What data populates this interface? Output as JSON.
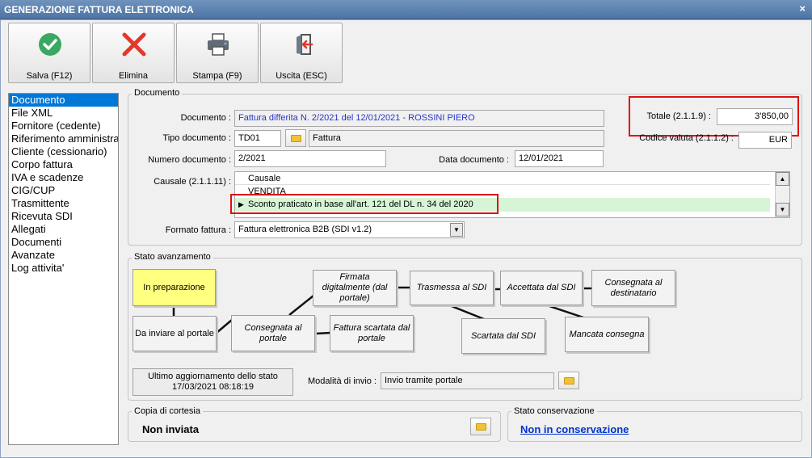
{
  "window": {
    "title": "GENERAZIONE FATTURA ELETTRONICA",
    "close": "×"
  },
  "toolbar": {
    "save": "Salva (F12)",
    "delete": "Elimina",
    "print": "Stampa (F9)",
    "exit": "Uscita (ESC)"
  },
  "nav": {
    "items": [
      "Documento",
      "File XML",
      "Fornitore (cedente)",
      "Riferimento amministrativo",
      "Cliente (cessionario)",
      "Corpo fattura",
      "IVA e scadenze",
      "CIG/CUP",
      "Trasmittente",
      "Ricevuta SDI",
      "Allegati",
      "Documenti",
      "Avanzate",
      "Log attivita'"
    ],
    "selected": "Documento"
  },
  "documento": {
    "group": "Documento",
    "doc_label": "Documento :",
    "doc_value": "Fattura differita N. 2/2021 del 12/01/2021 - ROSSINI PIERO",
    "totale_label": "Totale (2.1.1.9) :",
    "totale_value": "3'850,00",
    "tipo_label": "Tipo documento :",
    "tipo_code": "TD01",
    "tipo_desc": "Fattura",
    "valuta_label": "Codice valuta (2.1.1.2) :",
    "valuta_value": "EUR",
    "numero_label": "Numero documento :",
    "numero_value": "2/2021",
    "data_label": "Data documento :",
    "data_value": "12/01/2021",
    "causale_label": "Causale (2.1.1.11) :",
    "causale_header": "Causale",
    "causale_rows": [
      "VENDITA",
      "Sconto praticato in base all'art. 121 del DL n. 34 del 2020"
    ],
    "formato_label": "Formato fattura :",
    "formato_value": "Fattura elettronica B2B (SDI v1.2)"
  },
  "stato": {
    "group": "Stato avanzamento",
    "nodes": {
      "prep": "In preparazione",
      "inviare": "Da inviare al portale",
      "consegnata_portale": "Consegnata al portale",
      "firmata": "Firmata digitalmente (dal portale)",
      "scartata_portale": "Fattura scartata dal portale",
      "trasmessa": "Trasmessa al SDI",
      "scartata_sdi": "Scartata dal SDI",
      "accettata": "Accettata dal SDI",
      "mancata": "Mancata consegna",
      "consegnata_dest": "Consegnata al destinatario"
    },
    "ultimo_line1": "Ultimo aggiornamento dello stato",
    "ultimo_line2": "17/03/2021 08:18:19",
    "modalita_label": "Modalità di invio :",
    "modalita_value": "Invio tramite portale"
  },
  "copia": {
    "group": "Copia di cortesia",
    "value": "Non inviata"
  },
  "conservazione": {
    "group": "Stato conservazione",
    "value": "Non in conservazione"
  },
  "colors": {
    "accent": "#0078d7",
    "current_state": "#ffff80",
    "highlight_row": "#d6f5d6",
    "annotation": "#e01010"
  }
}
